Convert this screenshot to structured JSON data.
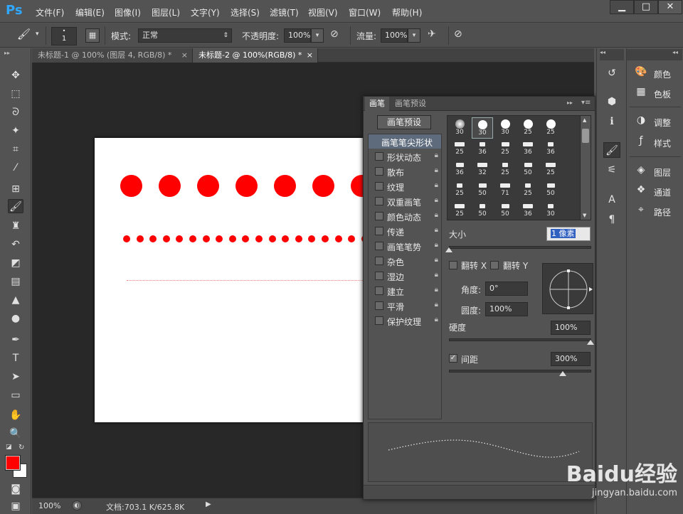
{
  "app": {
    "logo": "Ps"
  },
  "menu": [
    "文件(F)",
    "编辑(E)",
    "图像(I)",
    "图层(L)",
    "文字(Y)",
    "选择(S)",
    "滤镜(T)",
    "视图(V)",
    "窗口(W)",
    "帮助(H)"
  ],
  "window_controls": [
    "▁",
    "□",
    "✕"
  ],
  "options": {
    "brush_size": "1",
    "mode_label": "模式:",
    "mode_value": "正常",
    "opacity_label": "不透明度:",
    "opacity_value": "100%",
    "flow_label": "流量:",
    "flow_value": "100%"
  },
  "doc_tabs": [
    {
      "label": "未标题-1 @ 100% (图层 4, RGB/8) *",
      "close": "×"
    },
    {
      "label": "未标题-2 @ 100%(RGB/8) *",
      "close": "×"
    }
  ],
  "status": {
    "zoom": "100%",
    "doc": "文档:703.1 K/625.8K"
  },
  "colors": {
    "foreground": "#ff0000",
    "background": "#ffffff",
    "dot": "#ff0000",
    "selection": "#5d6b7c"
  },
  "canvas": {
    "big_dots_count": 7,
    "small_dots_count": 20
  },
  "brush_panel": {
    "tabs": [
      "画笔",
      "画笔预设"
    ],
    "preset_button": "画笔预设",
    "tip_shape": "画笔笔尖形状",
    "options": [
      {
        "label": "形状动态",
        "checked": false
      },
      {
        "label": "散布",
        "checked": false
      },
      {
        "label": "纹理",
        "checked": false
      },
      {
        "label": "双重画笔",
        "checked": false
      },
      {
        "label": "颜色动态",
        "checked": false
      },
      {
        "label": "传递",
        "checked": false
      },
      {
        "label": "画笔笔势",
        "checked": false
      },
      {
        "label": "杂色",
        "checked": false
      },
      {
        "label": "湿边",
        "checked": false
      },
      {
        "label": "建立",
        "checked": false
      },
      {
        "label": "平滑",
        "checked": false
      },
      {
        "label": "保护纹理",
        "checked": false
      }
    ],
    "tip_sizes": [
      "30",
      "30",
      "30",
      "25",
      "25",
      "25",
      "36",
      "25",
      "36",
      "36",
      "36",
      "32",
      "25",
      "50",
      "25",
      "25",
      "50",
      "71",
      "25",
      "50",
      "25",
      "50",
      "50",
      "36",
      "30"
    ],
    "size_label": "大小",
    "size_value": "1 像素",
    "flip_x": "翻转 X",
    "flip_y": "翻转 Y",
    "angle_label": "角度:",
    "angle_value": "0°",
    "roundness_label": "圆度:",
    "roundness_value": "100%",
    "hardness_label": "硬度",
    "hardness_value": "100%",
    "spacing_label": "间距",
    "spacing_value": "300%",
    "spacing_checked": true
  },
  "dock_panels": [
    {
      "icon": "color-icon",
      "label": "颜色"
    },
    {
      "icon": "swatches-icon",
      "label": "色板"
    },
    {
      "icon": "adjustments-icon",
      "label": "调整"
    },
    {
      "icon": "styles-icon",
      "label": "样式"
    },
    {
      "icon": "layers-icon",
      "label": "图层"
    },
    {
      "icon": "channels-icon",
      "label": "通道"
    },
    {
      "icon": "paths-icon",
      "label": "路径"
    }
  ],
  "watermark": {
    "brand": "Baidu经验",
    "url": "jingyan.baidu.com"
  }
}
